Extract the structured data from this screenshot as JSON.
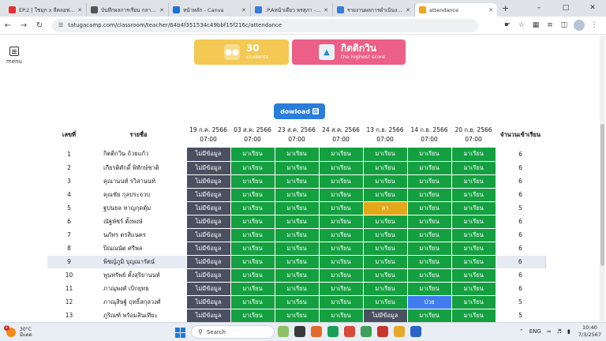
{
  "browser": {
    "tabs": [
      {
        "title": "EP.2 [ ใช่มุก x ลีคลอฟ ] -",
        "favicon_color": "#e5322d",
        "favicon_icon": "audio-icon"
      },
      {
        "title": "บันทึกผลการเรียน กลางภาค",
        "favicon_color": "#555555",
        "favicon_icon": "web-icon"
      },
      {
        "title": "หน้าหลัก - Canva",
        "favicon_color": "#1d73d6",
        "favicon_icon": "canva-icon"
      },
      {
        "title": ":P.Aหน้าเดียว พรสุภา - A4",
        "favicon_color": "#3a7be0",
        "favicon_icon": "doc-icon"
      },
      {
        "title": "รายงานผลการดำเนินงานแผน",
        "favicon_color": "#3a7be0",
        "favicon_icon": "doc-icon"
      },
      {
        "title": "attendance",
        "favicon_color": "#f2a41c",
        "favicon_icon": "globe-icon",
        "active": true
      }
    ],
    "url": "tatugacamp.com/classroom/teacher/64b4f351534c49bbf15f216c/attendance"
  },
  "sidebar": {
    "menu_label": "menu"
  },
  "stats": {
    "students_count": "30",
    "students_label": "students",
    "top_name": "กิตติกวิน",
    "top_label": "the highest score"
  },
  "download": {
    "label": "dowload"
  },
  "table": {
    "num_header": "เลขที่",
    "name_header": "รายชื่อ",
    "total_header": "จำนวนเข้าเรียน",
    "dates": [
      {
        "date": "19 ก.ค. 2566",
        "time": "07:00"
      },
      {
        "date": "03 ส.ค. 2566",
        "time": "07:00"
      },
      {
        "date": "23 ส.ค. 2566",
        "time": "07:00"
      },
      {
        "date": "24 ส.ค. 2566",
        "time": "07:00"
      },
      {
        "date": "13 ก.ย. 2566",
        "time": "07:00"
      },
      {
        "date": "14 ก.ย. 2566",
        "time": "07:00"
      },
      {
        "date": "20 ก.ย. 2566",
        "time": "07:00"
      }
    ],
    "status_labels": {
      "nodata": "ไม่มีข้อมูล",
      "present": "มาเรียน",
      "leave": "ลา",
      "sick": "ป่วย"
    },
    "status_colors": {
      "nodata": "#4a5060",
      "present": "#14a040",
      "leave": "#e3a81a",
      "sick": "#3f7cf0"
    },
    "rows": [
      {
        "num": "1",
        "name": "กิตติกวิน ถ้วยแก้ว",
        "statuses": [
          "nodata",
          "present",
          "present",
          "present",
          "present",
          "present",
          "present"
        ],
        "total": "6"
      },
      {
        "num": "2",
        "name": "เกียรติศักดิ์ พิทักษ์ชาติ",
        "statuses": [
          "nodata",
          "present",
          "present",
          "present",
          "present",
          "present",
          "present"
        ],
        "total": "6"
      },
      {
        "num": "3",
        "name": "คุณานนท์ รวิสานนท์",
        "statuses": [
          "nodata",
          "present",
          "present",
          "present",
          "present",
          "present",
          "present"
        ],
        "total": "6"
      },
      {
        "num": "4",
        "name": "คุณชัย กุลประจวบ",
        "statuses": [
          "nodata",
          "present",
          "present",
          "present",
          "present",
          "present",
          "present"
        ],
        "total": "6"
      },
      {
        "num": "5",
        "name": "ฐปนยล หาญกุดตุ้ม",
        "statuses": [
          "nodata",
          "present",
          "present",
          "present",
          "leave",
          "present",
          "present"
        ],
        "total": "5"
      },
      {
        "num": "6",
        "name": "ณัฐพัชร์ ตั้งพงษ์",
        "statuses": [
          "nodata",
          "present",
          "present",
          "present",
          "present",
          "present",
          "present"
        ],
        "total": "6"
      },
      {
        "num": "7",
        "name": "นภัทร ตรสิแนตร",
        "statuses": [
          "nodata",
          "present",
          "present",
          "present",
          "present",
          "present",
          "present"
        ],
        "total": "6"
      },
      {
        "num": "8",
        "name": "ปิณณนัต ศรีพล",
        "statuses": [
          "nodata",
          "present",
          "present",
          "present",
          "present",
          "present",
          "present"
        ],
        "total": "6"
      },
      {
        "num": "9",
        "name": "พิชญ์ภูมิ บุญณารัตน์",
        "statuses": [
          "nodata",
          "present",
          "present",
          "present",
          "present",
          "present",
          "present"
        ],
        "total": "6",
        "highlight": true
      },
      {
        "num": "10",
        "name": "พูนทรัพย์ ตั้งสุริยานนท์",
        "statuses": [
          "nodata",
          "present",
          "present",
          "present",
          "present",
          "present",
          "present"
        ],
        "total": "6"
      },
      {
        "num": "11",
        "name": "ภาณุพงศ์ เบิกยุทธ",
        "statuses": [
          "nodata",
          "present",
          "present",
          "present",
          "present",
          "present",
          "present"
        ],
        "total": "6"
      },
      {
        "num": "12",
        "name": "ภาณุสิษฐ์ ฤทธิ์สกุลวงศ์",
        "statuses": [
          "nodata",
          "present",
          "present",
          "present",
          "present",
          "sick",
          "present"
        ],
        "total": "5"
      },
      {
        "num": "13",
        "name": "ภูริณฑ์ พร้อมสินเทียะ",
        "statuses": [
          "nodata",
          "present",
          "present",
          "present",
          "nodata",
          "present",
          "present"
        ],
        "total": "5"
      }
    ]
  },
  "taskbar": {
    "weather_temp": "30°C",
    "weather_desc": "มีแดด",
    "notif_count": "1",
    "search_placeholder": "Search",
    "lang": "ENG",
    "time": "10:40",
    "date": "7/3/2567"
  }
}
